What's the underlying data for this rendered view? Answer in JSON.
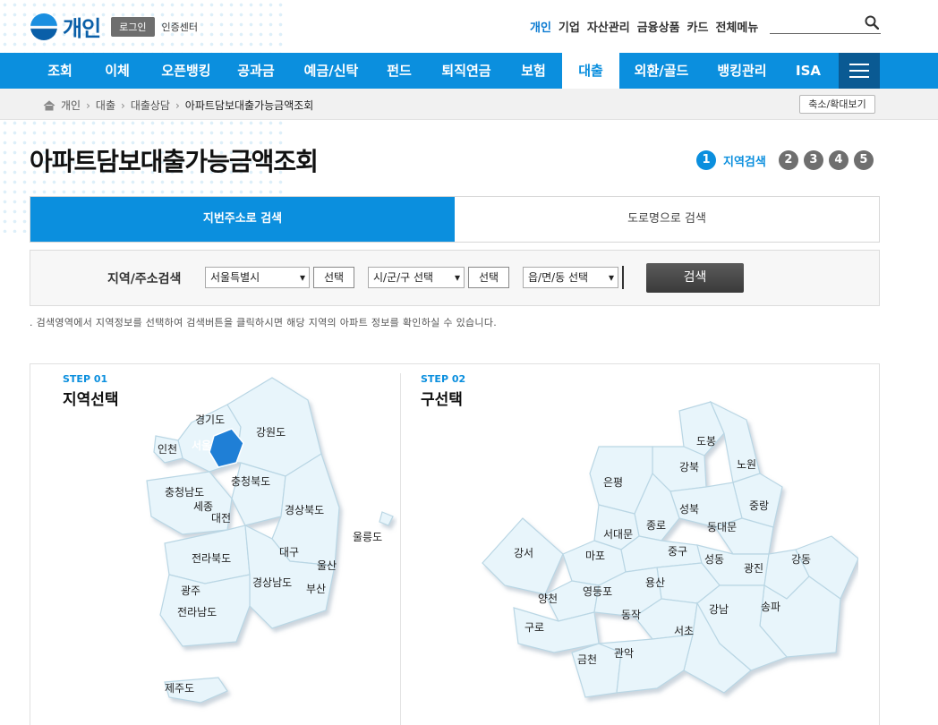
{
  "header": {
    "logo_text": "개인",
    "login_label": "로그인",
    "cert_label": "인증센터",
    "util_nav": [
      "개인",
      "기업",
      "자산관리",
      "금융상품",
      "카드",
      "전체메뉴"
    ],
    "search_icon": "search-icon"
  },
  "gnb": {
    "items": [
      "조회",
      "이체",
      "오픈뱅킹",
      "공과금",
      "예금/신탁",
      "펀드",
      "퇴직연금",
      "보험",
      "대출",
      "외환/골드",
      "뱅킹관리",
      "ISA"
    ],
    "active": "대출",
    "menu_icon": "hamburger-icon"
  },
  "breadcrumb": {
    "items": [
      "개인",
      "대출",
      "대출상담",
      "아파트담보대출가능금액조회"
    ],
    "zoom_label": "축소/확대보기"
  },
  "page": {
    "title": "아파트담보대출가능금액조회",
    "steps": [
      "1",
      "2",
      "3",
      "4",
      "5"
    ],
    "current_step_label": "지역검색"
  },
  "tabs": [
    "지번주소로 검색",
    "도로명으로 검색"
  ],
  "search": {
    "label": "지역/주소검색",
    "sido_value": "서울특별시",
    "sigungu_value": "시/군/구 선택",
    "dong_value": "읍/면/동 선택",
    "select_label": "선택",
    "submit_label": "검색",
    "help_text": "검색영역에서 지역정보를 선택하여 검색버튼을 클릭하시면 해당 지역의 아파트 정보를 확인하실 수 있습니다."
  },
  "map1": {
    "step": "STEP 01",
    "title": "지역선택",
    "regions": [
      "경기도",
      "강원도",
      "인천",
      "서울",
      "충청북도",
      "충청남도",
      "세종",
      "대전",
      "경상북도",
      "울릉도",
      "대구",
      "전라북도",
      "울산",
      "경상남도",
      "광주",
      "부산",
      "전라남도",
      "제주도"
    ],
    "selected": "서울"
  },
  "map2": {
    "step": "STEP 02",
    "title": "구선택",
    "districts": [
      "도봉",
      "노원",
      "강북",
      "은평",
      "중랑",
      "성북",
      "종로",
      "동대문",
      "서대문",
      "강서",
      "마포",
      "중구",
      "성동",
      "광진",
      "강동",
      "용산",
      "양천",
      "영등포",
      "동작",
      "송파",
      "강남",
      "구로",
      "서초",
      "금천",
      "관악"
    ]
  },
  "colors": {
    "primary": "#0b8fde",
    "map_fill": "#e8f5fb",
    "map_selected": "#1f7fd6"
  }
}
